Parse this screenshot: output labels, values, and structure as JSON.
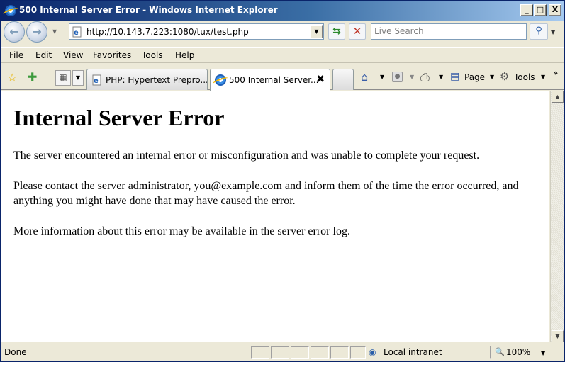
{
  "window": {
    "title": "500 Internal Server Error - Windows Internet Explorer",
    "minimize": "_",
    "maximize": "□",
    "close": "X"
  },
  "address_bar": {
    "url": "http://10.143.7.223:1080/tux/test.php",
    "search_placeholder": "Live Search"
  },
  "menu": [
    "File",
    "Edit",
    "View",
    "Favorites",
    "Tools",
    "Help"
  ],
  "tabs": [
    {
      "label": "PHP: Hypertext Prepro...",
      "active": false
    },
    {
      "label": "500 Internal Server...",
      "active": true
    }
  ],
  "command_bar": {
    "page_label": "Page",
    "tools_label": "Tools",
    "more": "»"
  },
  "content": {
    "heading": "Internal Server Error",
    "p1": "The server encountered an internal error or misconfiguration and was unable to complete your request.",
    "p2": "Please contact the server administrator, you@example.com and inform them of the time the error occurred, and anything you might have done that may have caused the error.",
    "p3": "More information about this error may be available in the server error log."
  },
  "status": {
    "text": "Done",
    "zone": "Local intranet",
    "zoom": "100%"
  },
  "icons": {
    "back": "back-arrow-icon",
    "forward": "forward-arrow-icon",
    "refresh": "refresh-icon",
    "stop": "stop-icon",
    "search": "search-icon",
    "favorites": "favorites-star-icon",
    "add_favorites": "add-favorites-icon",
    "home": "home-icon",
    "feeds": "feeds-icon",
    "print": "print-icon",
    "page": "page-icon",
    "tools": "gear-icon",
    "zone": "globe-icon",
    "zoom": "zoom-icon"
  }
}
